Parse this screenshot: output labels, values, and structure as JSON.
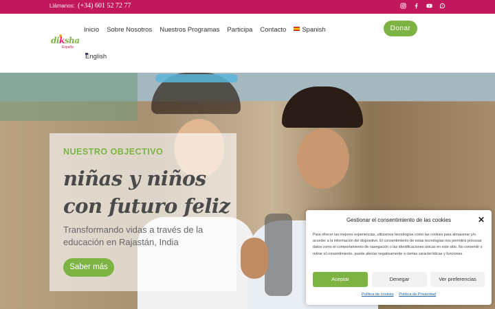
{
  "topbar": {
    "phone_label": "Llámanos:",
    "phone_number": "(+34) 601 52 72 77",
    "social_icons": [
      "instagram-icon",
      "facebook-icon",
      "youtube-icon",
      "whatsapp-icon"
    ]
  },
  "header": {
    "logo_text": "diksha",
    "logo_sub": "España",
    "nav": [
      "Inicio",
      "Sobre Nosotros",
      "Nuestros Programas",
      "Participa",
      "Contacto"
    ],
    "lang_spanish": "Spanish",
    "lang_english": "English",
    "donate": "Donar"
  },
  "hero": {
    "kicker": "NUESTRO OBJECTIVO",
    "headline": "niñas y niños con futuro feliz",
    "description": "Transformando vidas a través de la educación en Rajastán, India",
    "cta": "Saber más"
  },
  "cookie": {
    "title": "Gestionar el consentimiento de las cookies",
    "body": "Para ofrecer las mejores experiencias, utilizamos tecnologías como las cookies para almacenar y/o acceder a la información del dispositivo. El consentimiento de estas tecnologías nos permitirá procesar datos como el comportamiento de navegación o las identificaciones únicas en este sitio. No consentir o retirar el consentimiento, puede afectar negativamente a ciertas características y funciones.",
    "accept": "Aceptar",
    "deny": "Denegar",
    "prefs": "Ver preferencias",
    "link_cookies": "Política de cookies",
    "link_privacy": "Política de Privacidad",
    "close_symbol": "✕"
  },
  "colors": {
    "brand_pink": "#c2185b",
    "brand_green": "#7cb342"
  }
}
